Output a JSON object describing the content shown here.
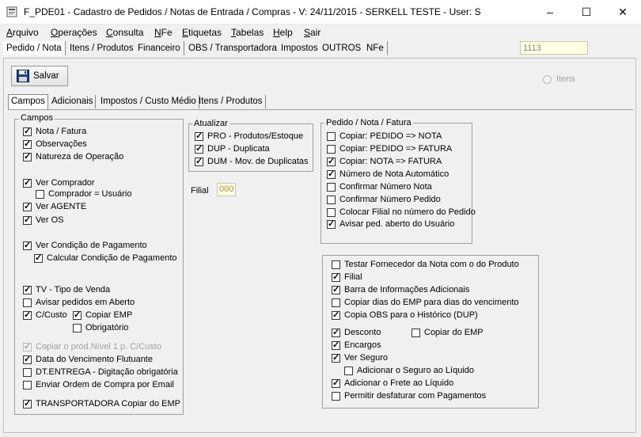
{
  "window": {
    "title": "F_PDE01 - Cadastro de Pedidos / Notas de Entrada / Compras - V: 24/11/2015 - SERKELL TESTE - User: S",
    "minimize": "–",
    "maximize": "☐",
    "close": "✕"
  },
  "menu": {
    "items": [
      {
        "u": "A",
        "rest": "rquivo"
      },
      {
        "u": "O",
        "rest": "perações"
      },
      {
        "u": "C",
        "rest": "onsulta"
      },
      {
        "u": "N",
        "rest": "Fe"
      },
      {
        "u": "E",
        "rest": "tiquetas"
      },
      {
        "u": "T",
        "rest": "abelas"
      },
      {
        "u": "H",
        "rest": "elp"
      },
      {
        "u": "S",
        "rest": "air"
      }
    ]
  },
  "main_tabs": [
    "Pedido / Nota",
    "Itens / Produtos",
    "Financeiro",
    "OBS / Transportadora",
    "Impostos",
    "OUTROS",
    "NFe"
  ],
  "code_field": "1113",
  "toolbar": {
    "save_label": "Salvar",
    "itens_radio": "Itens"
  },
  "sub_tabs": [
    "Campos",
    "Adicionais",
    "Impostos / Custo Médio",
    "Itens / Produtos"
  ],
  "campos": {
    "legend": "Campos",
    "items": [
      {
        "label": "Nota / Fatura",
        "checked": true
      },
      {
        "label": "Observações",
        "checked": true
      },
      {
        "label": "Natureza de Operação",
        "checked": true
      },
      {
        "label": "Ver Comprador",
        "checked": true
      },
      {
        "label": "Comprador = Usuário",
        "checked": false
      },
      {
        "label": "Ver AGENTE",
        "checked": true
      },
      {
        "label": "Ver OS",
        "checked": true
      },
      {
        "label": "Ver Condição de Pagamento",
        "checked": true
      },
      {
        "label": "Calcular Condição de Pagamento",
        "checked": true
      },
      {
        "label": "TV - Tipo de Venda",
        "checked": true
      },
      {
        "label": "Avisar pedidos em Aberto",
        "checked": false
      },
      {
        "label": "C/Custo",
        "checked": true
      },
      {
        "label": "Copiar EMP",
        "checked": true
      },
      {
        "label": "Obrigatório",
        "checked": false
      },
      {
        "label": "Copiar o prod.Nível 1 p. C/Custo",
        "checked": true
      },
      {
        "label": "Data do Vencimento Flutuante",
        "checked": true
      },
      {
        "label": "DT.ENTREGA - Digitação obrigatória",
        "checked": false
      },
      {
        "label": "Enviar Ordem de Compra por Email",
        "checked": false
      },
      {
        "label": "TRANSPORTADORA Copiar do EMP",
        "checked": true
      }
    ]
  },
  "atualizar": {
    "legend": "Atualizar",
    "items": [
      {
        "label": "PRO - Produtos/Estoque",
        "checked": true
      },
      {
        "label": "DUP - Duplicata",
        "checked": true
      },
      {
        "label": "DUM - Mov. de Duplicatas",
        "checked": true
      }
    ]
  },
  "filial": {
    "label": "Filial",
    "value": "000"
  },
  "pedido_nota": {
    "legend": "Pedido / Nota / Fatura",
    "items": [
      {
        "label": "Copiar: PEDIDO => NOTA",
        "checked": false
      },
      {
        "label": "Copiar: PEDIDO => FATURA",
        "checked": false
      },
      {
        "label": "Copiar: NOTA => FATURA",
        "checked": true
      },
      {
        "label": "Número de Nota Automático",
        "checked": true
      },
      {
        "label": "Confirmar Número Nota",
        "checked": false
      },
      {
        "label": "Confirmar Número Pedido",
        "checked": false
      },
      {
        "label": "Colocar Filial no número do Pedido",
        "checked": false
      },
      {
        "label": "Avisar ped. aberto do Usuário",
        "checked": true
      }
    ]
  },
  "outros": {
    "items": [
      {
        "label": "Testar Fornecedor da Nota com o do Produto",
        "checked": false
      },
      {
        "label": "Filial",
        "checked": true
      },
      {
        "label": "Barra de Informações Adicionais",
        "checked": true
      },
      {
        "label": "Copiar dias do EMP para dias do vencimento",
        "checked": false
      },
      {
        "label": "Copia OBS para o Histórico (DUP)",
        "checked": true
      },
      {
        "label": "Desconto",
        "checked": true
      },
      {
        "label": "Copiar do EMP",
        "checked": false
      },
      {
        "label": "Encargos",
        "checked": true
      },
      {
        "label": "Ver Seguro",
        "checked": true
      },
      {
        "label": "Adicionar o Seguro ao Líquido",
        "checked": false
      },
      {
        "label": "Adicionar o Frete ao Líquido",
        "checked": true
      },
      {
        "label": "Permitir desfaturar com Pagamentos",
        "checked": false
      }
    ]
  }
}
